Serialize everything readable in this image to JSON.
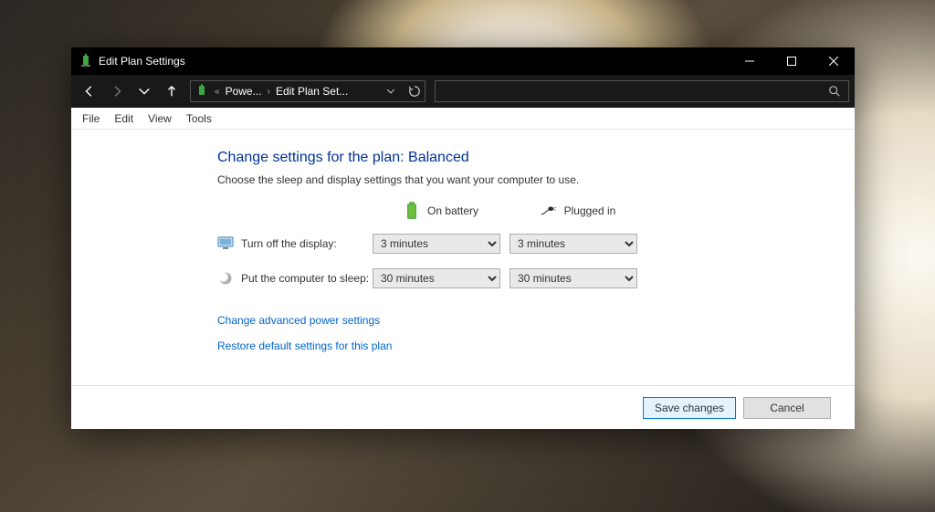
{
  "window": {
    "title": "Edit Plan Settings"
  },
  "breadcrumb": {
    "first": "Powe...",
    "second": "Edit Plan Set..."
  },
  "menu": {
    "file": "File",
    "edit": "Edit",
    "view": "View",
    "tools": "Tools"
  },
  "main": {
    "heading": "Change settings for the plan: Balanced",
    "subheading": "Choose the sleep and display settings that you want your computer to use.",
    "col_battery": "On battery",
    "col_plugged": "Plugged in",
    "row_display": "Turn off the display:",
    "row_sleep": "Put the computer to sleep:",
    "display_battery_value": "3 minutes",
    "display_plugged_value": "3 minutes",
    "sleep_battery_value": "30 minutes",
    "sleep_plugged_value": "30 minutes",
    "link_advanced": "Change advanced power settings",
    "link_restore": "Restore default settings for this plan"
  },
  "footer": {
    "save": "Save changes",
    "cancel": "Cancel"
  }
}
